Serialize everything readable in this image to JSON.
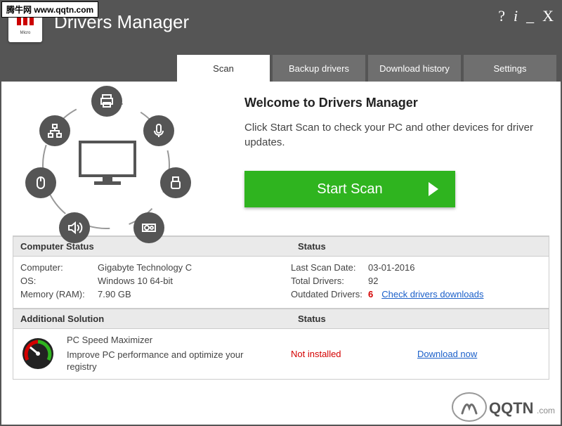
{
  "url_badge": "腾牛网 www.qqtn.com",
  "app_title": "Drivers Manager",
  "tabs": {
    "scan": "Scan",
    "backup": "Backup drivers",
    "download_history": "Download history",
    "settings": "Settings"
  },
  "welcome": {
    "heading": "Welcome to Drivers Manager",
    "body": "Click Start Scan to check your PC and other devices for driver updates.",
    "button": "Start Scan"
  },
  "computer_status": {
    "header": "Computer Status",
    "status_header": "Status",
    "computer_label": "Computer:",
    "computer_value": "Gigabyte Technology C",
    "os_label": "OS:",
    "os_value": "Windows 10 64-bit",
    "ram_label": "Memory (RAM):",
    "ram_value": "7.90 GB",
    "last_scan_label": "Last Scan Date:",
    "last_scan_value": "03-01-2016",
    "total_drivers_label": "Total Drivers:",
    "total_drivers_value": "92",
    "outdated_label": "Outdated Drivers:",
    "outdated_value": "6",
    "check_link": "Check drivers downloads"
  },
  "additional": {
    "header": "Additional Solution",
    "status_header": "Status",
    "product": "PC Speed Maximizer",
    "desc": "Improve PC performance and optimize your registry",
    "status": "Not installed",
    "download_link": "Download now"
  }
}
